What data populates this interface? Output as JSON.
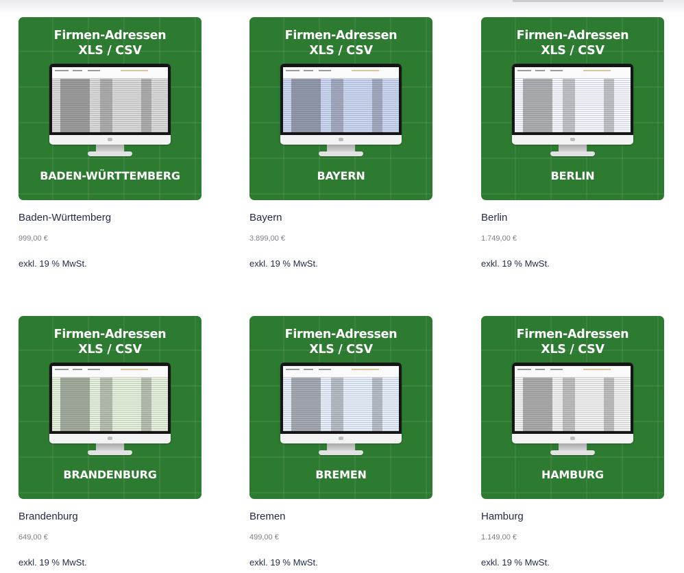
{
  "products": [
    {
      "thumb_title": "Firmen-Adressen",
      "thumb_format": "XLS / CSV",
      "thumb_region": "BADEN-WÜRTTEMBERG",
      "name": "Baden-Württemberg",
      "price": "999,00 €",
      "tax_note": "exkl. 19 % MwSt.",
      "screen_tint": "#dadada"
    },
    {
      "thumb_title": "Firmen-Adressen",
      "thumb_format": "XLS / CSV",
      "thumb_region": "BAYERN",
      "name": "Bayern",
      "price": "3.899,00 €",
      "tax_note": "exkl. 19 % MwSt.",
      "screen_tint": "#cbd6f2"
    },
    {
      "thumb_title": "Firmen-Adressen",
      "thumb_format": "XLS / CSV",
      "thumb_region": "BERLIN",
      "name": "Berlin",
      "price": "1.749,00 €",
      "tax_note": "exkl. 19 % MwSt.",
      "screen_tint": "#f4f7fd"
    },
    {
      "thumb_title": "Firmen-Adressen",
      "thumb_format": "XLS / CSV",
      "thumb_region": "BRANDENBURG",
      "name": "Brandenburg",
      "price": "649,00 €",
      "tax_note": "exkl. 19 % MwSt.",
      "screen_tint": "#e5f1dc"
    },
    {
      "thumb_title": "Firmen-Adressen",
      "thumb_format": "XLS / CSV",
      "thumb_region": "BREMEN",
      "name": "Bremen",
      "price": "499,00 €",
      "tax_note": "exkl. 19 % MwSt.",
      "screen_tint": "#e7effc"
    },
    {
      "thumb_title": "Firmen-Adressen",
      "thumb_format": "XLS / CSV",
      "thumb_region": "HAMBURG",
      "name": "Hamburg",
      "price": "1.149,00 €",
      "tax_note": "exkl. 19 % MwSt.",
      "screen_tint": "#f1f1f1"
    }
  ],
  "colors": {
    "thumb_background": "#2d7a31",
    "product_name": "#1e2a47",
    "price": "#7b7f86"
  }
}
